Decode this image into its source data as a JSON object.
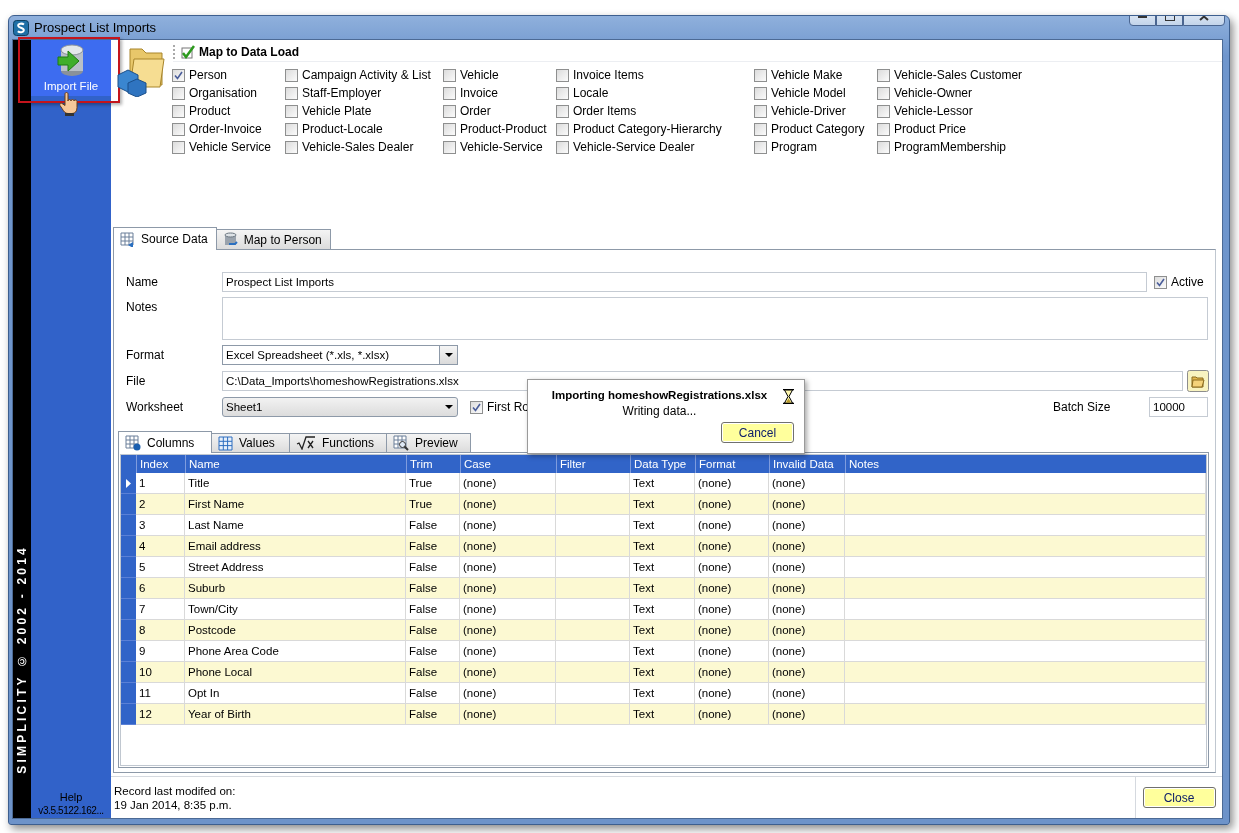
{
  "window": {
    "title": "Prospect List Imports"
  },
  "sidebar": {
    "import_button": {
      "label": "Import File",
      "selected": true,
      "highlighted": true
    },
    "brand": "SIMPLICITY © 2002 - 2014",
    "help": "Help",
    "version": "v3.5.5122.162..."
  },
  "map_to_data_load": {
    "title": "Map to Data Load",
    "items": [
      {
        "label": "Person",
        "checked": true
      },
      {
        "label": "Organisation",
        "checked": false
      },
      {
        "label": "Product",
        "checked": false
      },
      {
        "label": "Order-Invoice",
        "checked": false
      },
      {
        "label": "Vehicle Service",
        "checked": false
      },
      {
        "label": "Campaign Activity & List",
        "checked": false
      },
      {
        "label": "Staff-Employer",
        "checked": false
      },
      {
        "label": "Vehicle Plate",
        "checked": false
      },
      {
        "label": "Product-Locale",
        "checked": false
      },
      {
        "label": "Vehicle-Sales Dealer",
        "checked": false
      },
      {
        "label": "Vehicle",
        "checked": false
      },
      {
        "label": "Invoice",
        "checked": false
      },
      {
        "label": "Order",
        "checked": false
      },
      {
        "label": "Product-Product",
        "checked": false
      },
      {
        "label": "Vehicle-Service",
        "checked": false
      },
      {
        "label": "Invoice Items",
        "checked": false
      },
      {
        "label": "Locale",
        "checked": false
      },
      {
        "label": "Order Items",
        "checked": false
      },
      {
        "label": "Product Category-Hierarchy",
        "checked": false
      },
      {
        "label": "Vehicle-Service Dealer",
        "checked": false
      },
      {
        "label": "Vehicle Make",
        "checked": false
      },
      {
        "label": "Vehicle Model",
        "checked": false
      },
      {
        "label": "Vehicle-Driver",
        "checked": false
      },
      {
        "label": "Product Category",
        "checked": false
      },
      {
        "label": "Program",
        "checked": false
      },
      {
        "label": "Vehicle-Sales Customer",
        "checked": false
      },
      {
        "label": "Vehicle-Owner",
        "checked": false
      },
      {
        "label": "Vehicle-Lessor",
        "checked": false
      },
      {
        "label": "Product Price",
        "checked": false
      },
      {
        "label": "ProgramMembership",
        "checked": false
      }
    ]
  },
  "tabs": [
    {
      "label": "Source Data",
      "selected": true
    },
    {
      "label": "Map to Person",
      "selected": false
    }
  ],
  "form": {
    "name_label": "Name",
    "name": "Prospect List Imports",
    "active_label": "Active",
    "active": true,
    "notes_label": "Notes",
    "format_label": "Format",
    "format": "Excel Spreadsheet (*.xls, *.xlsx)",
    "file_label": "File",
    "file": "C:\\Data_Imports\\homeshowRegistrations.xlsx",
    "worksheet_label": "Worksheet",
    "worksheet": "Sheet1",
    "first_row_label": "First Ro",
    "first_row": true,
    "batch_size_label": "Batch Size",
    "batch_size": "10000"
  },
  "grid_tabs": [
    {
      "label": "Columns",
      "selected": true
    },
    {
      "label": "Values",
      "selected": false
    },
    {
      "label": "Functions",
      "selected": false
    },
    {
      "label": "Preview",
      "selected": false
    }
  ],
  "grid": {
    "columns": [
      "Index",
      "Name",
      "Trim",
      "Case",
      "Filter",
      "Data Type",
      "Format",
      "Invalid Data",
      "Notes"
    ],
    "rows": [
      {
        "current": true,
        "index": "1",
        "name": "Title",
        "trim": "True",
        "case": "(none)",
        "data_type": "Text",
        "format": "(none)",
        "invalid_data": "(none)"
      },
      {
        "current": false,
        "index": "2",
        "name": "First Name",
        "trim": "True",
        "case": "(none)",
        "data_type": "Text",
        "format": "(none)",
        "invalid_data": "(none)"
      },
      {
        "current": false,
        "index": "3",
        "name": "Last Name",
        "trim": "False",
        "case": "(none)",
        "data_type": "Text",
        "format": "(none)",
        "invalid_data": "(none)"
      },
      {
        "current": false,
        "index": "4",
        "name": "Email address",
        "trim": "False",
        "case": "(none)",
        "data_type": "Text",
        "format": "(none)",
        "invalid_data": "(none)"
      },
      {
        "current": false,
        "index": "5",
        "name": "Street Address",
        "trim": "False",
        "case": "(none)",
        "data_type": "Text",
        "format": "(none)",
        "invalid_data": "(none)"
      },
      {
        "current": false,
        "index": "6",
        "name": "Suburb",
        "trim": "False",
        "case": "(none)",
        "data_type": "Text",
        "format": "(none)",
        "invalid_data": "(none)"
      },
      {
        "current": false,
        "index": "7",
        "name": "Town/City",
        "trim": "False",
        "case": "(none)",
        "data_type": "Text",
        "format": "(none)",
        "invalid_data": "(none)"
      },
      {
        "current": false,
        "index": "8",
        "name": "Postcode",
        "trim": "False",
        "case": "(none)",
        "data_type": "Text",
        "format": "(none)",
        "invalid_data": "(none)"
      },
      {
        "current": false,
        "index": "9",
        "name": "Phone Area Code",
        "trim": "False",
        "case": "(none)",
        "data_type": "Text",
        "format": "(none)",
        "invalid_data": "(none)"
      },
      {
        "current": false,
        "index": "10",
        "name": "Phone Local",
        "trim": "False",
        "case": "(none)",
        "data_type": "Text",
        "format": "(none)",
        "invalid_data": "(none)"
      },
      {
        "current": false,
        "index": "11",
        "name": "Opt In",
        "trim": "False",
        "case": "(none)",
        "data_type": "Text",
        "format": "(none)",
        "invalid_data": "(none)"
      },
      {
        "current": false,
        "index": "12",
        "name": "Year of Birth",
        "trim": "False",
        "case": "(none)",
        "data_type": "Text",
        "format": "(none)",
        "invalid_data": "(none)"
      }
    ]
  },
  "dialog": {
    "title": "Importing homeshowRegistrations.xlsx",
    "message": "Writing data...",
    "button": "Cancel"
  },
  "status_bar": {
    "label": "Record last modifed on:",
    "value": "19 Jan 2014, 8:35 p.m.",
    "close_button": "Close"
  }
}
